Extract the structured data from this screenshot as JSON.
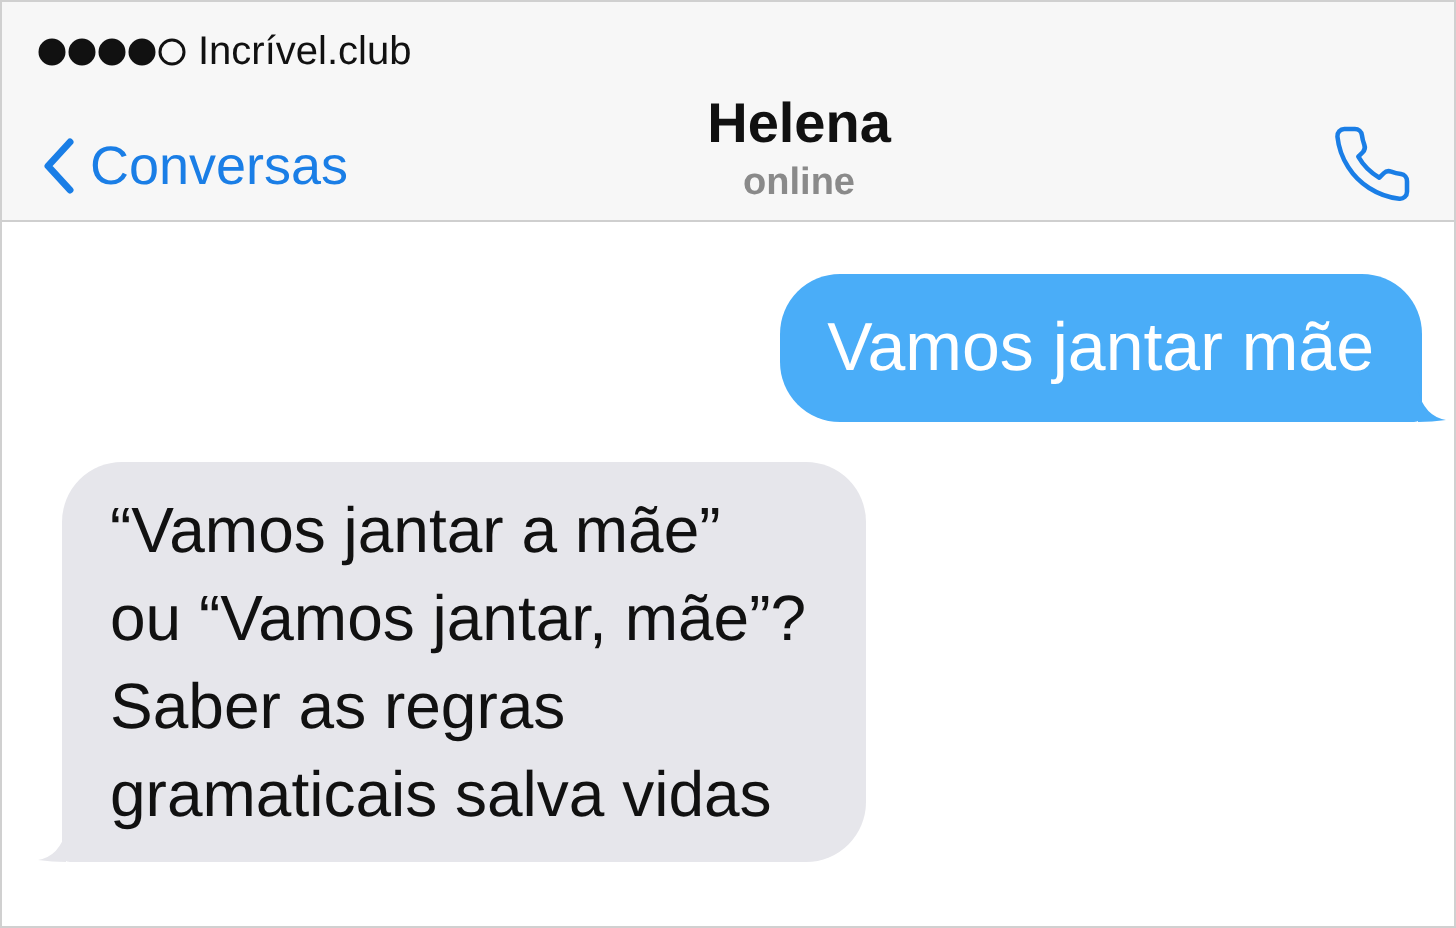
{
  "status_bar": {
    "carrier": "Incrível.club"
  },
  "header": {
    "back_label": "Conversas",
    "title": "Helena",
    "subtitle": "online"
  },
  "messages": [
    {
      "kind": "sent",
      "text": "Vamos jantar mãe"
    },
    {
      "kind": "received",
      "lines": [
        "“Vamos jantar a mãe”",
        "ou “Vamos jantar, mãe”?",
        "Saber as regras",
        "gramaticais salva vidas"
      ]
    }
  ]
}
